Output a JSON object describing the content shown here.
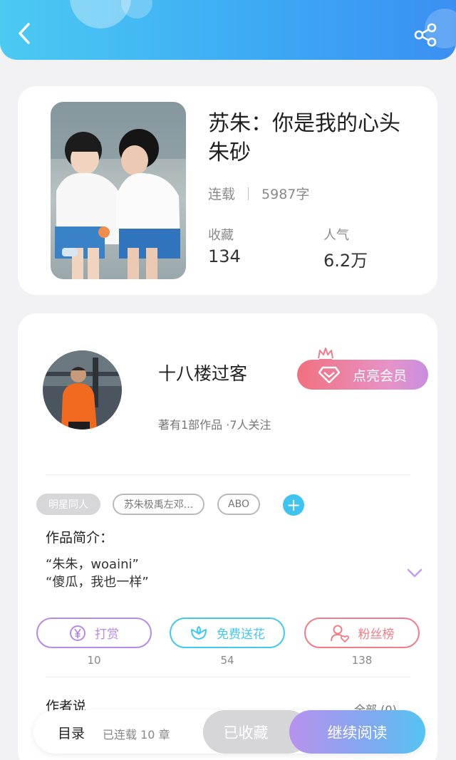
{
  "book": {
    "title": "苏朱：你是我的心头朱砂",
    "status": "连载",
    "word_count": "5987字",
    "stats": [
      {
        "label": "收藏",
        "value": "134"
      },
      {
        "label": "人气",
        "value": "6.2万"
      }
    ]
  },
  "author": {
    "name": "十八楼过客",
    "meta": "著有1部作品 ·7人关注",
    "vip_label": "点亮会员"
  },
  "tags": [
    "明星同人",
    "苏朱极禹左邓...",
    "ABO"
  ],
  "add_tag_symbol": "+",
  "intro": {
    "title": "作品简介：",
    "lines": [
      "“朱朱，woaini”",
      "“傻瓜，我也一样”"
    ]
  },
  "actions": [
    {
      "label": "打赏",
      "count": "10",
      "color": "#b68be8"
    },
    {
      "label": "免费送花",
      "count": "54",
      "color": "#45c8ee"
    },
    {
      "label": "粉丝榜",
      "count": "138",
      "color": "#f07d88"
    }
  ],
  "author_say": {
    "title": "作者说",
    "all_label": "全部 (0)"
  },
  "bottom_bar": {
    "toc_label": "目录",
    "chapters_label": "已连载 10 章",
    "collected_label": "已收藏",
    "read_label": "继续阅读"
  }
}
